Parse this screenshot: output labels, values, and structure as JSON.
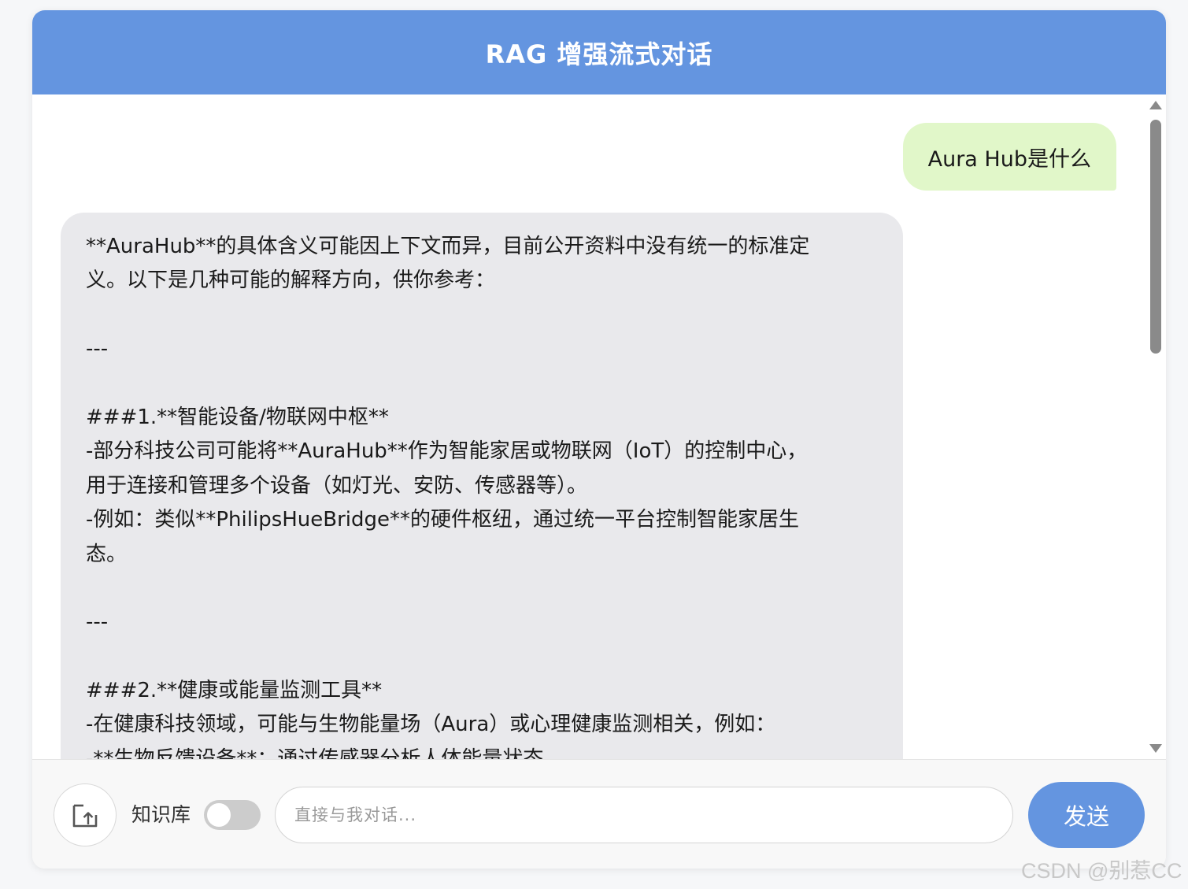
{
  "header": {
    "title": "RAG 增强流式对话"
  },
  "messages": {
    "user": "Aura Hub是什么",
    "bot_lines": [
      "**AuraHub**的具体含义可能因上下文而异，目前公开资料中没有统一的标准定",
      "义。以下是几种可能的解释方向，供你参考：",
      "",
      "---",
      "",
      "###1.**智能设备/物联网中枢**",
      "-部分科技公司可能将**AuraHub**作为智能家居或物联网（IoT）的控制中心，",
      "用于连接和管理多个设备（如灯光、安防、传感器等）。",
      "-例如：类似**PhilipsHueBridge**的硬件枢纽，通过统一平台控制智能家居生",
      "态。",
      "",
      "---",
      "",
      "###2.**健康或能量监测工具**",
      "-在健康科技领域，可能与生物能量场（Aura）或心理健康监测相关，例如：",
      "-**生物反馈设备**：通过传感器分析人体能量状态"
    ]
  },
  "footer": {
    "knowledge_base_label": "知识库",
    "knowledge_base_enabled": false,
    "input_placeholder": "直接与我对话...",
    "send_label": "发送"
  },
  "watermark": "CSDN @别惹CC",
  "colors": {
    "accent": "#6495e0",
    "user_bubble": "#e1f7c9",
    "bot_bubble": "#e9e9ec"
  },
  "icons": {
    "upload": "upload-icon"
  }
}
